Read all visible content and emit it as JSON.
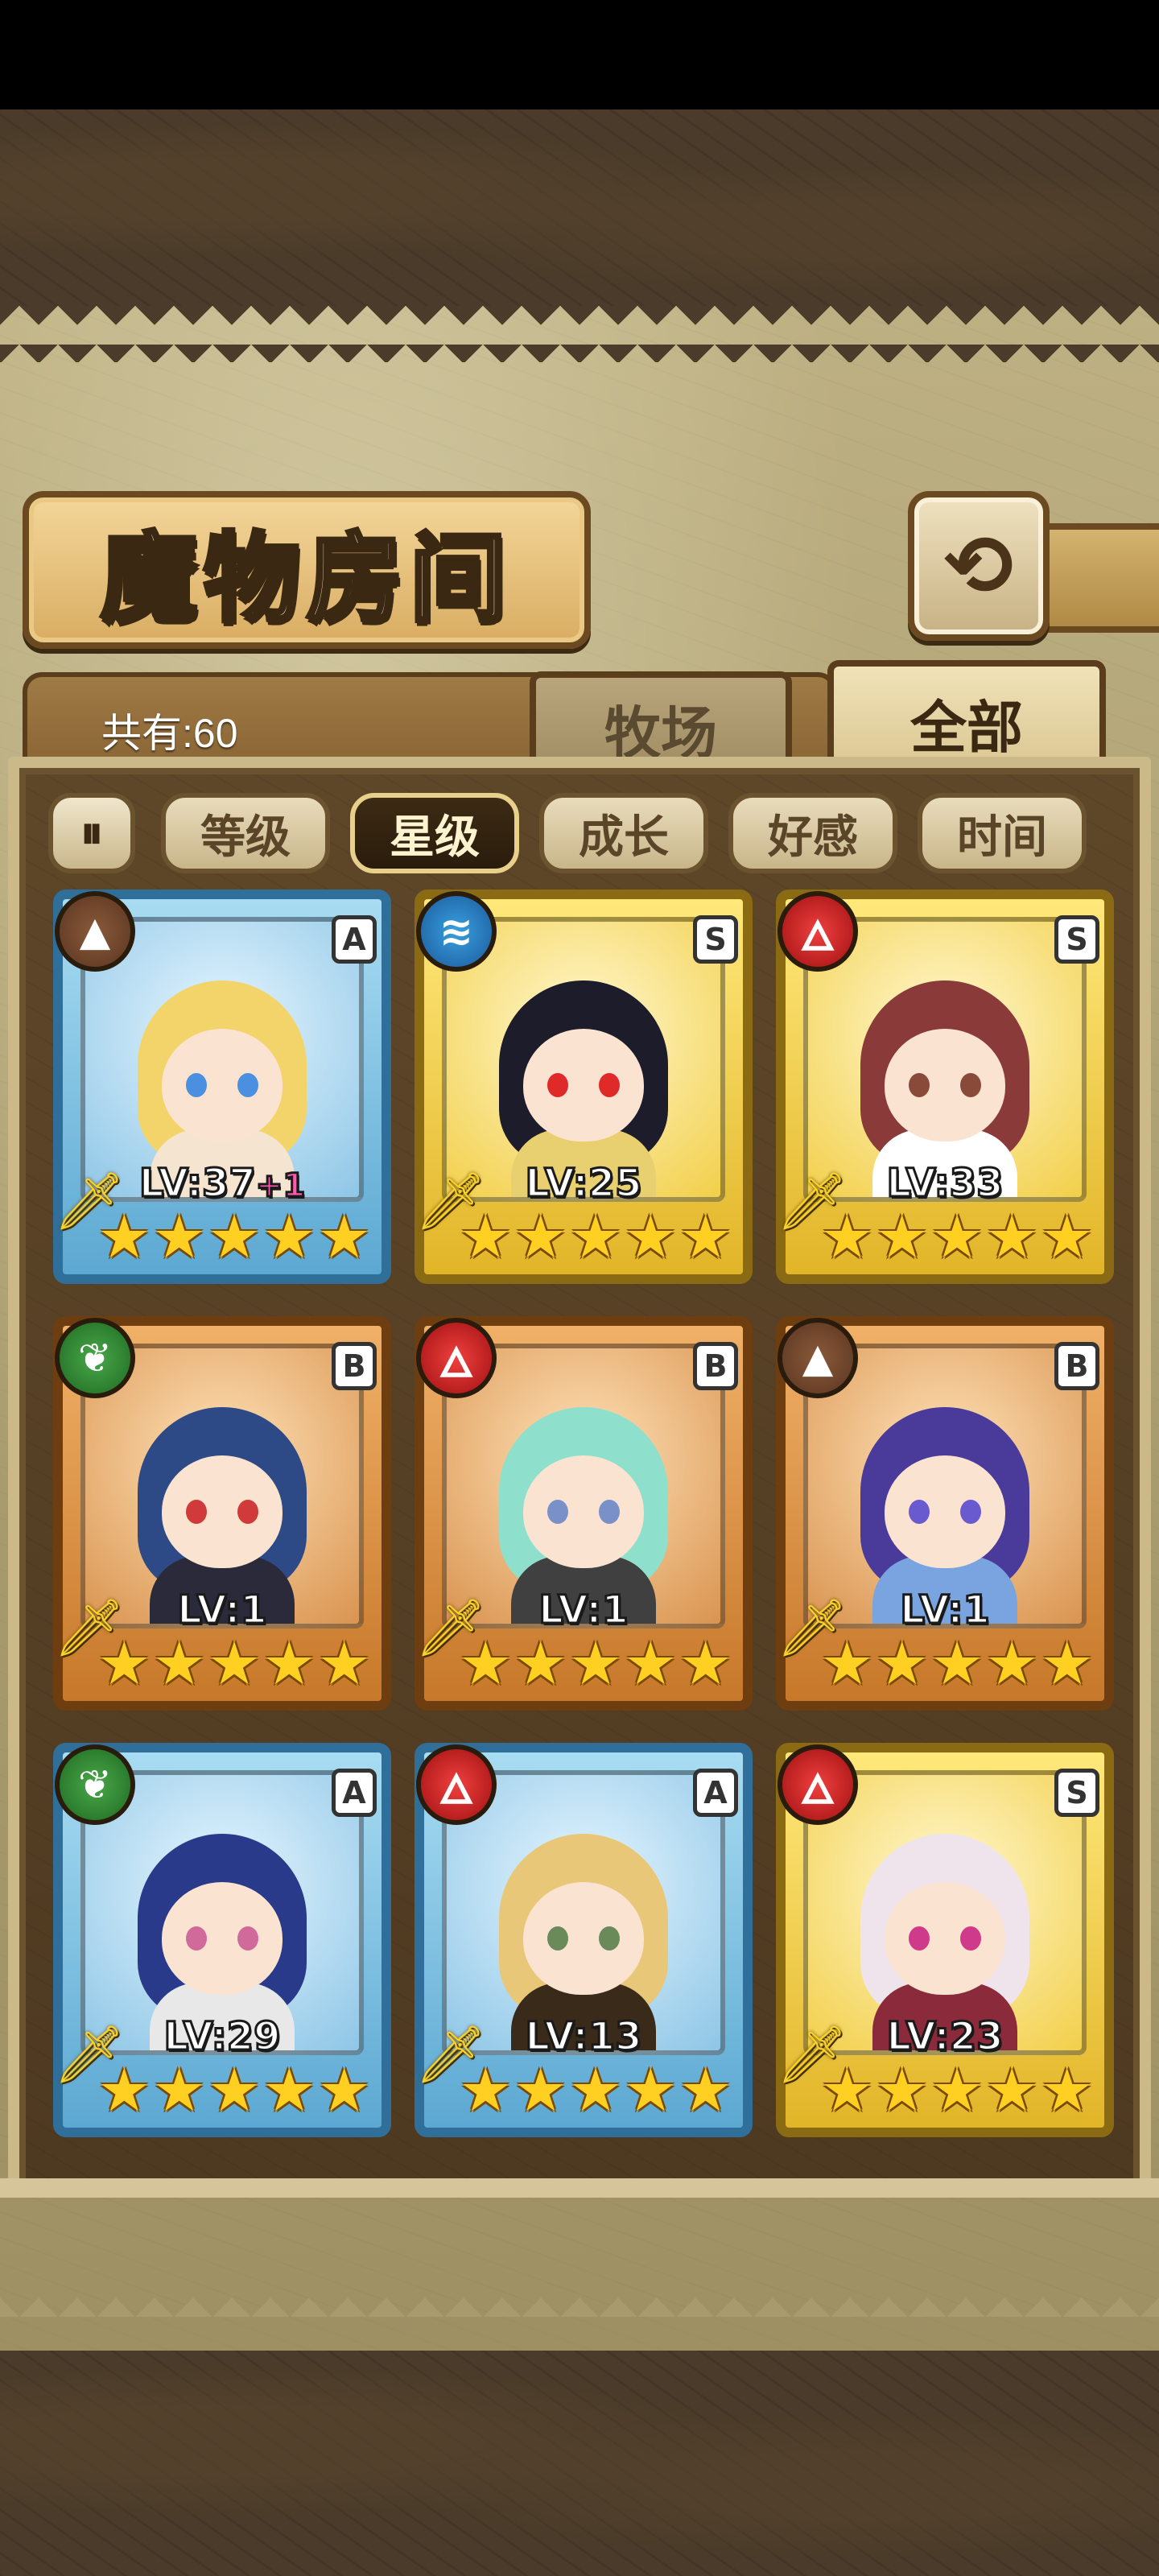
{
  "header": {
    "title": "魔物房间",
    "back_icon": "⟲"
  },
  "tabs": {
    "count_label": "共有:60",
    "ranch": "牧场",
    "all": "全部"
  },
  "filters": {
    "toggle_icon": "⏸",
    "items": [
      "等级",
      "星级",
      "成长",
      "好感",
      "时间"
    ],
    "active": "星级"
  },
  "monsters": [
    {
      "rank": "A",
      "element": "earth",
      "level": "LV:37",
      "bonus": "+1",
      "stars": 5,
      "hair": "#f3d46a",
      "eye": "#4b8fe0",
      "body": "#f5e4d0"
    },
    {
      "rank": "S",
      "element": "water",
      "level": "LV:25",
      "bonus": "",
      "stars": 5,
      "hair": "#1c1c2a",
      "eye": "#e02a2a",
      "body": "#e8d070"
    },
    {
      "rank": "S",
      "element": "fire",
      "level": "LV:33",
      "bonus": "",
      "stars": 5,
      "hair": "#8a3a38",
      "eye": "#8a4a3a",
      "body": "#ffffff"
    },
    {
      "rank": "B",
      "element": "wind",
      "level": "LV:1",
      "bonus": "",
      "stars": 5,
      "hair": "#2d4a86",
      "eye": "#d03a3a",
      "body": "#2a2a3a"
    },
    {
      "rank": "B",
      "element": "fire",
      "level": "LV:1",
      "bonus": "",
      "stars": 5,
      "hair": "#8ee0cc",
      "eye": "#7a90c8",
      "body": "#404040"
    },
    {
      "rank": "B",
      "element": "earth",
      "level": "LV:1",
      "bonus": "",
      "stars": 5,
      "hair": "#4a3a9a",
      "eye": "#6a5ad0",
      "body": "#7aa4e0"
    },
    {
      "rank": "A",
      "element": "wind",
      "level": "LV:29",
      "bonus": "",
      "stars": 5,
      "hair": "#2a3a8a",
      "eye": "#d06a9a",
      "body": "#e8e8e8"
    },
    {
      "rank": "A",
      "element": "fire",
      "level": "LV:13",
      "bonus": "",
      "stars": 5,
      "hair": "#e8c878",
      "eye": "#6a8a5a",
      "body": "#3a2a1a"
    },
    {
      "rank": "S",
      "element": "fire",
      "level": "LV:23",
      "bonus": "",
      "stars": 5,
      "hair": "#f0e4ec",
      "eye": "#d03a8a",
      "body": "#8a2a3a"
    }
  ],
  "element_icons": {
    "earth": "▲",
    "water": "≋",
    "fire": "🜂",
    "wind": "❦"
  },
  "colors": {
    "active_filter": "#2a1c0c",
    "star": "#ffcf22"
  }
}
